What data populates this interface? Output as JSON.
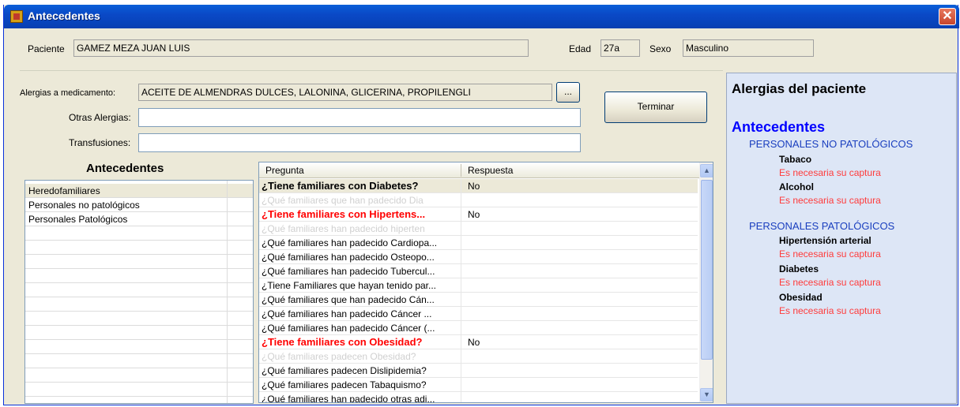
{
  "window": {
    "title": "Antecedentes",
    "close": "✕"
  },
  "patient": {
    "label": "Paciente",
    "name": "GAMEZ MEZA JUAN LUIS",
    "age_label": "Edad",
    "age": "27a",
    "sex_label": "Sexo",
    "sex": "Masculino"
  },
  "form": {
    "allergies_label": "Alergias a medicamento:",
    "allergies_value": "ACEITE DE ALMENDRAS DULCES, LALONINA, GLICERINA, PROPILENGLI",
    "browse_label": "...",
    "other_label": "Otras Alergias:",
    "other_value": "",
    "transfusions_label": "Transfusiones:",
    "transfusions_value": "",
    "finish_label": "Terminar"
  },
  "antecedentes_list": {
    "title": "Antecedentes",
    "items": [
      "Heredofamiliares",
      "Personales no patológicos",
      "Personales Patológicos"
    ]
  },
  "grid": {
    "col_question": "Pregunta",
    "col_answer": "Respuesta",
    "rows": [
      {
        "q": "¿Tiene familiares con Diabetes?",
        "r": "No"
      },
      {
        "q": "¿Qué familiares que han padecido Dia",
        "r": ""
      },
      {
        "q": "¿Tiene familiares con Hipertens...",
        "r": "No"
      },
      {
        "q": "¿Qué familiares han padecido hiperten",
        "r": ""
      },
      {
        "q": "¿Qué familiares han padecido Cardiopa...",
        "r": ""
      },
      {
        "q": "¿Qué familiares han padecido Osteopo...",
        "r": ""
      },
      {
        "q": "¿Qué familiares han padecido Tubercul...",
        "r": ""
      },
      {
        "q": "¿Tiene Familiares que hayan tenido par...",
        "r": ""
      },
      {
        "q": "¿Qué familiares que han padecido Cán...",
        "r": ""
      },
      {
        "q": "¿Qué familiares han padecido Cáncer ...",
        "r": ""
      },
      {
        "q": "¿Qué familiares han padecido Cáncer (...",
        "r": ""
      },
      {
        "q": "¿Tiene familiares con Obesidad?",
        "r": "No"
      },
      {
        "q": "¿Qué familiares padecen Obesidad?",
        "r": ""
      },
      {
        "q": "¿Qué familiares padecen Dislipidemia?",
        "r": ""
      },
      {
        "q": "¿Qué familiares padecen Tabaquismo?",
        "r": ""
      },
      {
        "q": "¿Qué familiares han padecido otras adi...",
        "r": ""
      }
    ],
    "scroll_up": "▲",
    "scroll_down": "▼"
  },
  "summary": {
    "title": "Alergias del paciente",
    "antecedentes": "Antecedentes",
    "sections": [
      {
        "name": "PERSONALES NO PATOLÓGICOS",
        "items": [
          {
            "name": "Tabaco",
            "note": "Es necesaria su captura"
          },
          {
            "name": "Alcohol",
            "note": "Es necesaria su captura"
          }
        ]
      },
      {
        "name": "PERSONALES PATOLÓGICOS",
        "items": [
          {
            "name": "Hipertensión arterial",
            "note": "Es necesaria su captura"
          },
          {
            "name": "Diabetes",
            "note": "Es necesaria su captura"
          },
          {
            "name": "Obesidad",
            "note": "Es necesaria su captura"
          }
        ]
      }
    ]
  },
  "colors": {
    "title_bar": "#0a49c7",
    "required_red": "#ff0000",
    "note_red": "#ff3b3b",
    "link_blue": "#0000ff",
    "panel_bg": "#dde6f6"
  }
}
